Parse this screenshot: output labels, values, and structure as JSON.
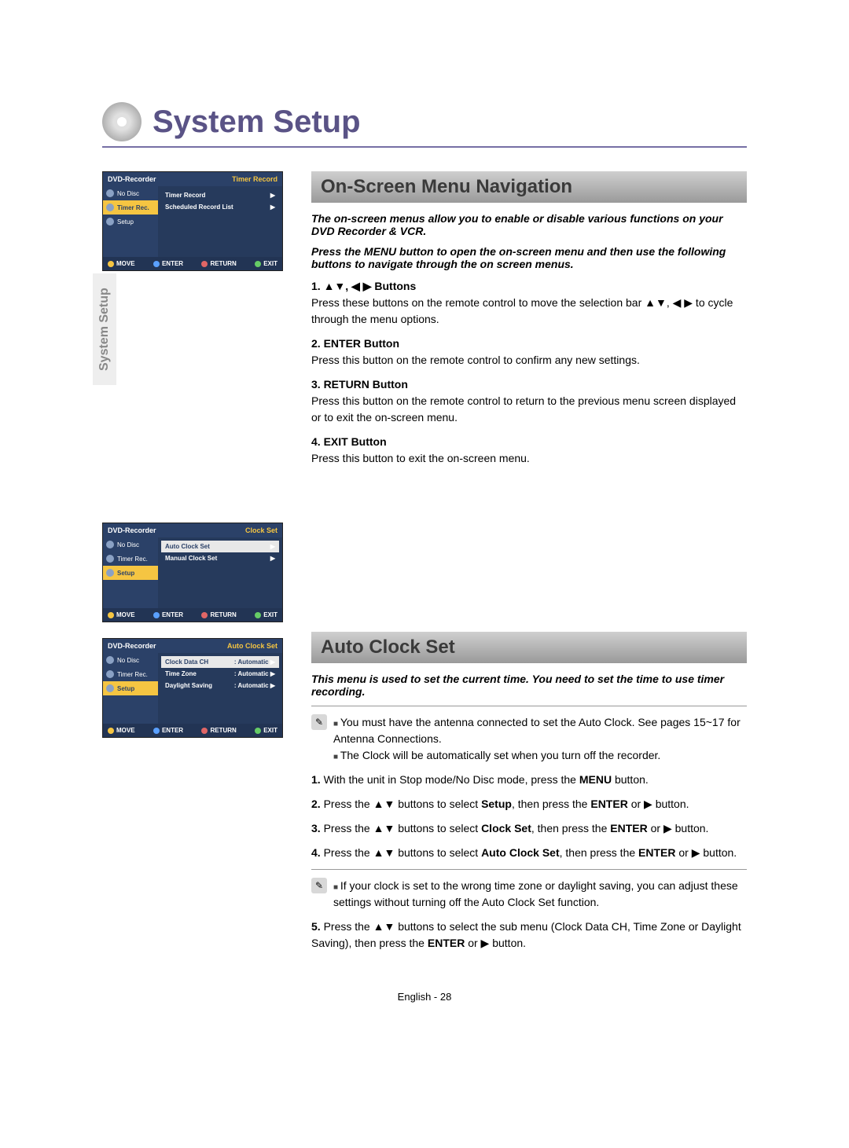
{
  "title": "System Setup",
  "sideTab": "System Setup",
  "footer": "English - 28",
  "nav": {
    "heading": "On-Screen Menu Navigation",
    "intro1": "The on-screen menus allow you to enable or disable various functions on your DVD Recorder & VCR.",
    "intro2": "Press the MENU button to open the on-screen menu and then use the following buttons to navigate through the on screen menus.",
    "s1_label": "1.  ▲▼, ◀ ▶  Buttons",
    "s1_body": "Press these buttons on the remote control to move the selection bar ▲▼, ◀ ▶ to cycle through the menu options.",
    "s2_label": "2.  ENTER Button",
    "s2_body": "Press this button on the remote control to confirm any new settings.",
    "s3_label": "3.  RETURN Button",
    "s3_body": "Press this button on the remote control to return to the previous menu screen displayed or to exit the on-screen menu.",
    "s4_label": "4.  EXIT Button",
    "s4_body": "Press this button to exit the on-screen menu."
  },
  "clk": {
    "heading": "Auto Clock Set",
    "intro": "This menu is used to set the current time. You need to set the time to use timer recording.",
    "note1a": "You must have the antenna connected to set the Auto Clock. See pages 15~17 for Antenna Connections.",
    "note1b": "The Clock will be automatically set when you turn off the recorder.",
    "note2": "If your clock is set to the wrong time zone or daylight saving, you can adjust these settings without turning off the Auto Clock Set function.",
    "s1_pre": "1. ",
    "s1_a": "With the unit in Stop mode/No Disc mode, press the ",
    "s1_b1": "MENU",
    "s1_c": " button.",
    "s2_pre": "2. ",
    "s2_a": "Press the  ▲▼ buttons to select ",
    "s2_b1": "Setup",
    "s2_b": ", then press the ",
    "s2_b2": "ENTER",
    "s2_c": " or ▶ button.",
    "s3_pre": "3. ",
    "s3_a": "Press the  ▲▼ buttons to select ",
    "s3_b1": "Clock Set",
    "s3_b": ", then press the ",
    "s3_b2": "ENTER",
    "s3_c": " or ▶ button.",
    "s4_pre": "4. ",
    "s4_a": "Press the  ▲▼ buttons to select ",
    "s4_b1": "Auto Clock Set",
    "s4_b": ", then press the ",
    "s4_b2": "ENTER",
    "s4_c": " or ▶ button.",
    "s5_pre": "5. ",
    "s5_a": "Press the  ▲▼ buttons to select the sub menu (Clock Data CH, Time Zone or Daylight Saving), then press the ",
    "s5_b1": "ENTER",
    "s5_c": " or ▶ button."
  },
  "osd": {
    "hdr": "DVD-Recorder",
    "nodisc": "No Disc",
    "timer": "Timer Rec.",
    "setup": "Setup",
    "ftr_move": "MOVE",
    "ftr_enter": "ENTER",
    "ftr_return": "RETURN",
    "ftr_exit": "EXIT",
    "a": {
      "rt": "Timer Record",
      "i1": "Timer Record",
      "i2": "Scheduled Record List"
    },
    "b": {
      "rt": "Clock Set",
      "i1": "Auto Clock Set",
      "i2": "Manual Clock Set"
    },
    "c": {
      "rt": "Auto Clock Set",
      "i1": "Clock Data CH",
      "v1": ": Automatic",
      "i2": "Time Zone",
      "v2": ": Automatic",
      "i3": "Daylight Saving",
      "v3": ": Automatic"
    }
  }
}
